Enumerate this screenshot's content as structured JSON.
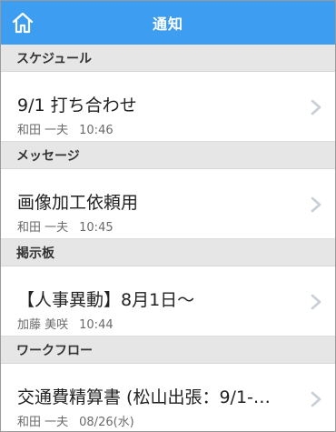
{
  "header": {
    "title": "通知",
    "home_icon": "home-icon"
  },
  "sections": [
    {
      "title": "スケジュール",
      "item": {
        "main": "9/1 打ち合わせ",
        "author": "和田 一夫",
        "time": "10:46"
      }
    },
    {
      "title": "メッセージ",
      "item": {
        "main": "画像加工依頼用",
        "author": "和田 一夫",
        "time": "10:45"
      }
    },
    {
      "title": "掲示板",
      "item": {
        "main": "【人事異動】8月1日～",
        "author": "加藤 美咲",
        "time": "10:44"
      }
    },
    {
      "title": "ワークフロー",
      "item": {
        "main": "交通費精算書 (松山出張：9/1-…",
        "author": "和田 一夫",
        "time": "08/26(水)"
      }
    }
  ],
  "colors": {
    "header": "#3d9df0",
    "section": "#e6e6e6",
    "chevron": "#c8ced6"
  }
}
